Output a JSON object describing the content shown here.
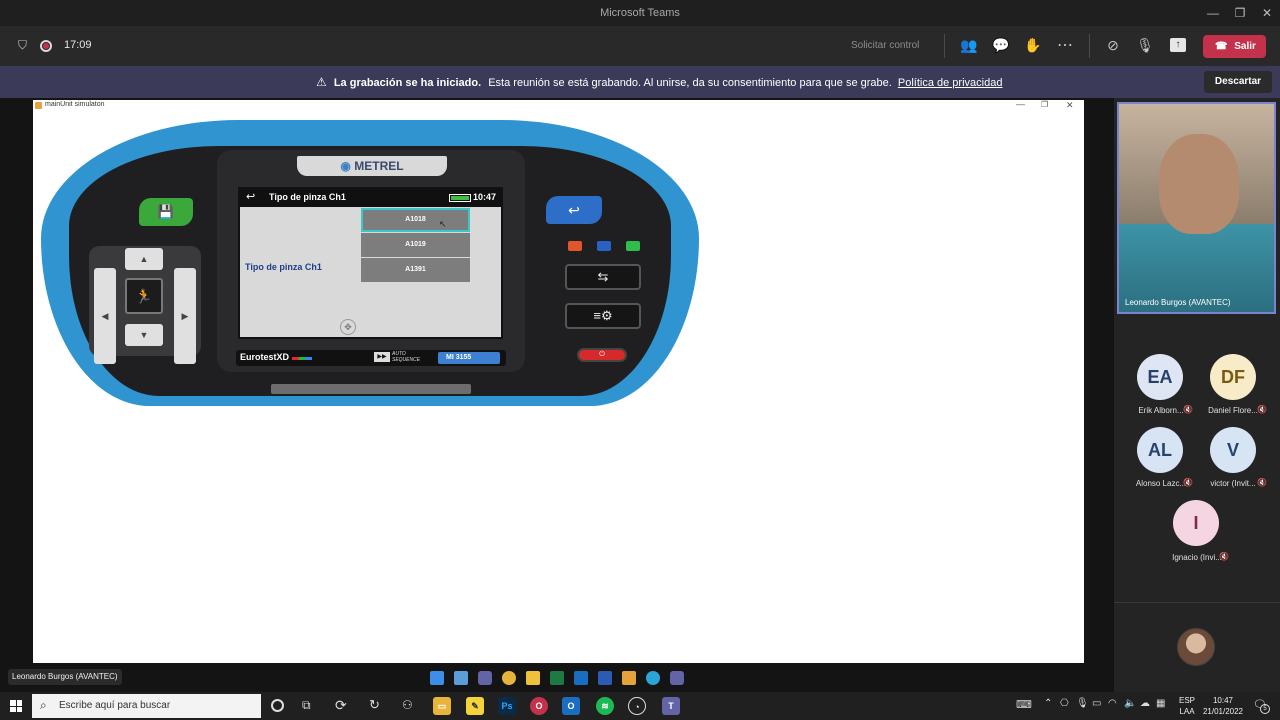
{
  "window": {
    "title": "Microsoft Teams"
  },
  "toolbar": {
    "timer": "17:09",
    "request_control": "Solicitar control",
    "leave_label": "Salir",
    "accent": "#c4314b"
  },
  "banner": {
    "bold_text": "La grabación se ha iniciado.",
    "text": "Esta reunión se está grabando. Al unirse, da su consentimiento para que se grabe.",
    "link": "Política de privacidad",
    "dismiss": "Descartar"
  },
  "simulator": {
    "window_title": "mainUnit simulaton",
    "brand": "METREL",
    "screen_title": "Tipo de pinza Ch1",
    "time": "10:47",
    "field_label": "Tipo de pinza Ch1",
    "options": [
      "A1018",
      "A1019",
      "A1391"
    ],
    "selected_option": "A1018",
    "model_left": "EurotestXD",
    "auto_top": "AUTO",
    "auto_bottom": "SEQUENCE",
    "model_right": "MI 3155"
  },
  "video": {
    "name": "Leonardo Burgos (AVANTEC)"
  },
  "participants": [
    {
      "initials": "EA",
      "name": "Erik Alborn...",
      "bg": "#dde6f2",
      "fg": "#28416b"
    },
    {
      "initials": "DF",
      "name": "Daniel Flore...",
      "bg": "#f7ebc8",
      "fg": "#7a5a10"
    },
    {
      "initials": "AL",
      "name": "Alonso Lazc...",
      "bg": "#d6e4f3",
      "fg": "#27446e"
    },
    {
      "initials": "V",
      "name": "victor (Invit...",
      "bg": "#d6e4f3",
      "fg": "#27446e"
    },
    {
      "initials": "I",
      "name": "Ignacio (Invi...",
      "bg": "#f5d5e2",
      "fg": "#7b2d4d"
    }
  ],
  "presenter_label": "Leonardo Burgos (AVANTEC)",
  "taskbar": {
    "search_placeholder": "Escribe aquí para buscar",
    "lang_top": "ESP",
    "lang_bottom": "LAA",
    "time": "10:47",
    "date": "21/01/2022",
    "notif_count": "5"
  }
}
